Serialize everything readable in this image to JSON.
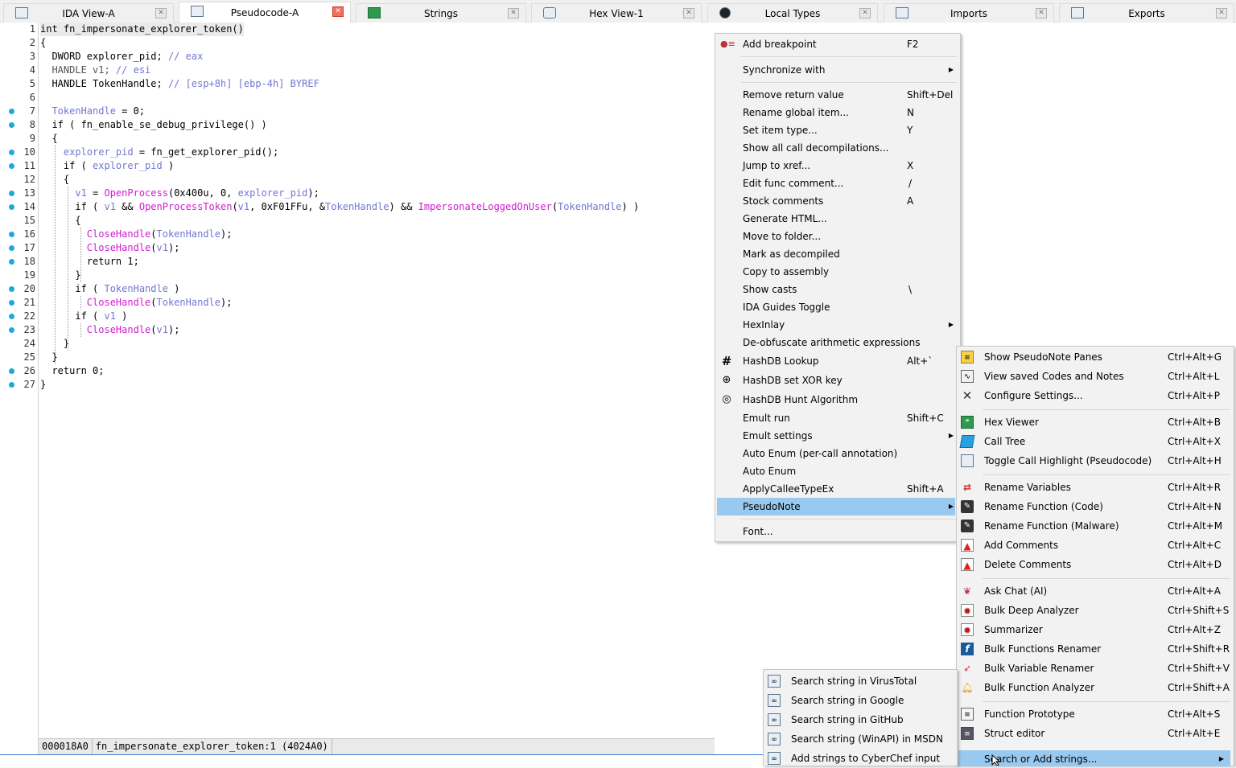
{
  "tabs": [
    {
      "label": "IDA View-A",
      "icon": "ida-view-icon"
    },
    {
      "label": "Pseudocode-A",
      "icon": "pseudocode-icon"
    },
    {
      "label": "Strings",
      "icon": "strings-icon"
    },
    {
      "label": "Hex View-1",
      "icon": "hex-view-icon"
    },
    {
      "label": "Local Types",
      "icon": "local-types-icon"
    },
    {
      "label": "Imports",
      "icon": "imports-icon"
    },
    {
      "label": "Exports",
      "icon": "exports-icon"
    }
  ],
  "line_numbers": [
    "1",
    "2",
    "3",
    "4",
    "5",
    "6",
    "7",
    "8",
    "9",
    "10",
    "11",
    "12",
    "13",
    "14",
    "15",
    "16",
    "17",
    "18",
    "19",
    "20",
    "21",
    "22",
    "23",
    "24",
    "25",
    "26",
    "27"
  ],
  "code": {
    "l1": "int fn_impersonate_explorer_token()",
    "l2": "{",
    "l3a": "  DWORD explorer_pid; ",
    "l3c": "// eax",
    "l4a": "  HANDLE v1; ",
    "l4c": "// esi",
    "l5a": "  HANDLE TokenHandle; ",
    "l5c": "// [esp+8h] [ebp-4h] BYREF",
    "l6": "",
    "l7a": "  TokenHandle",
    "l7b": " = 0;",
    "l8": "  if ( fn_enable_se_debug_privilege() )",
    "l9": "  {",
    "l10a": "    explorer_pid",
    "l10b": " = fn_get_explorer_pid();",
    "l11a": "    if ( ",
    "l11b": "explorer_pid",
    "l11c": " )",
    "l12": "    {",
    "l13a": "      v1",
    "l13b": " = ",
    "l13c": "OpenProcess",
    "l13d": "(0x400u, 0, ",
    "l13e": "explorer_pid",
    "l13f": ");",
    "l14a": "      if ( ",
    "l14b": "v1",
    "l14c": " && ",
    "l14d": "OpenProcessToken",
    "l14e": "(",
    "l14f": "v1",
    "l14g": ", 0xF01FFu, &",
    "l14h": "TokenHandle",
    "l14i": ") && ",
    "l14j": "ImpersonateLoggedOnUser",
    "l14k": "(",
    "l14l": "TokenHandle",
    "l14m": ") )",
    "l15": "      {",
    "l16a": "        ",
    "l16b": "CloseHandle",
    "l16c": "(",
    "l16d": "TokenHandle",
    "l16e": ");",
    "l17a": "        ",
    "l17b": "CloseHandle",
    "l17c": "(",
    "l17d": "v1",
    "l17e": ");",
    "l18": "        return 1;",
    "l19": "      }",
    "l20a": "      if ( ",
    "l20b": "TokenHandle",
    "l20c": " )",
    "l21a": "        ",
    "l21b": "CloseHandle",
    "l21c": "(",
    "l21d": "TokenHandle",
    "l21e": ");",
    "l22a": "      if ( ",
    "l22b": "v1",
    "l22c": " )",
    "l23a": "        ",
    "l23b": "CloseHandle",
    "l23c": "(",
    "l23d": "v1",
    "l23e": ");",
    "l24": "    }",
    "l25": "  }",
    "l26": "  return 0;",
    "l27": "}"
  },
  "status": {
    "address": "000018A0",
    "location": "fn_impersonate_explorer_token:1 (4024A0)"
  },
  "context_menu": [
    {
      "label": "Add breakpoint",
      "shortcut": "F2",
      "icon": "breakpoint-icon"
    },
    {
      "label": "Synchronize with",
      "shortcut": ""
    },
    {
      "label": "Remove return value",
      "shortcut": "Shift+Del"
    },
    {
      "label": "Rename global item...",
      "shortcut": "N"
    },
    {
      "label": "Set item type...",
      "shortcut": "Y"
    },
    {
      "label": "Show all call decompilations...",
      "shortcut": ""
    },
    {
      "label": "Jump to xref...",
      "shortcut": "X"
    },
    {
      "label": "Edit func comment...",
      "shortcut": "/"
    },
    {
      "label": "Stock comments",
      "shortcut": "A"
    },
    {
      "label": "Generate HTML...",
      "shortcut": ""
    },
    {
      "label": "Move to folder...",
      "shortcut": ""
    },
    {
      "label": "Mark as decompiled",
      "shortcut": ""
    },
    {
      "label": "Copy to assembly",
      "shortcut": ""
    },
    {
      "label": "Show casts",
      "shortcut": "\\"
    },
    {
      "label": "IDA Guides Toggle",
      "shortcut": ""
    },
    {
      "label": "HexInlay",
      "shortcut": ""
    },
    {
      "label": "De-obfuscate arithmetic expressions",
      "shortcut": ""
    },
    {
      "label": "HashDB Lookup",
      "shortcut": "Alt+`",
      "icon": "hash-icon"
    },
    {
      "label": "HashDB set XOR key",
      "shortcut": "",
      "icon": "xor-icon"
    },
    {
      "label": "HashDB Hunt Algorithm",
      "shortcut": "",
      "icon": "target-icon"
    },
    {
      "label": "Emult run",
      "shortcut": "Shift+C"
    },
    {
      "label": "Emult settings",
      "shortcut": ""
    },
    {
      "label": "Auto Enum (per-call annotation)",
      "shortcut": ""
    },
    {
      "label": "Auto Enum",
      "shortcut": ""
    },
    {
      "label": "ApplyCalleeTypeEx",
      "shortcut": "Shift+A"
    },
    {
      "label": "PseudoNote",
      "shortcut": ""
    },
    {
      "label": "Font...",
      "shortcut": ""
    }
  ],
  "pseudonote_menu": [
    {
      "label": "Show PseudoNote Panes",
      "shortcut": "Ctrl+Alt+G",
      "icon": "notes-icon"
    },
    {
      "label": "View saved Codes and Notes",
      "shortcut": "Ctrl+Alt+L",
      "icon": "chart-icon"
    },
    {
      "label": "Configure Settings...",
      "shortcut": "Ctrl+Alt+P",
      "icon": "tools-icon"
    },
    {
      "label": "Hex Viewer",
      "shortcut": "Ctrl+Alt+B",
      "icon": "hex-icon"
    },
    {
      "label": "Call Tree",
      "shortcut": "Ctrl+Alt+X",
      "icon": "tree-icon"
    },
    {
      "label": "Toggle Call Highlight (Pseudocode)",
      "shortcut": "Ctrl+Alt+H",
      "icon": "highlight-icon"
    },
    {
      "label": "Rename Variables",
      "shortcut": "Ctrl+Alt+R",
      "icon": "rename-icon"
    },
    {
      "label": "Rename Function (Code)",
      "shortcut": "Ctrl+Alt+N",
      "icon": "pen-icon"
    },
    {
      "label": "Rename Function (Malware)",
      "shortcut": "Ctrl+Alt+M",
      "icon": "pen-icon"
    },
    {
      "label": "Add Comments",
      "shortcut": "Ctrl+Alt+C",
      "icon": "comment-icon"
    },
    {
      "label": "Delete Comments",
      "shortcut": "Ctrl+Alt+D",
      "icon": "comment-icon"
    },
    {
      "label": "Ask Chat (AI)",
      "shortcut": "Ctrl+Alt+A",
      "icon": "chat-icon"
    },
    {
      "label": "Bulk Deep Analyzer",
      "shortcut": "Ctrl+Shift+S",
      "icon": "bug-icon"
    },
    {
      "label": "Summarizer",
      "shortcut": "Ctrl+Alt+Z",
      "icon": "bug-icon"
    },
    {
      "label": "Bulk Functions Renamer",
      "shortcut": "Ctrl+Shift+R",
      "icon": "function-icon"
    },
    {
      "label": "Bulk Variable Renamer",
      "shortcut": "Ctrl+Shift+V",
      "icon": "rocket-icon"
    },
    {
      "label": "Bulk Function Analyzer",
      "shortcut": "Ctrl+Shift+A",
      "icon": "bell-icon"
    },
    {
      "label": "Function Prototype",
      "shortcut": "Ctrl+Alt+S",
      "icon": "prototype-icon"
    },
    {
      "label": "Struct editor",
      "shortcut": "Ctrl+Alt+E",
      "icon": "struct-icon"
    },
    {
      "label": "Search or Add strings...",
      "shortcut": "",
      "icon": ""
    }
  ],
  "strings_menu": [
    {
      "label": "Search string in VirusTotal",
      "icon": "binoculars-icon"
    },
    {
      "label": "Search string in Google",
      "icon": "binoculars-icon"
    },
    {
      "label": "Search string in GitHub",
      "icon": "binoculars-icon"
    },
    {
      "label": "Search string (WinAPI) in MSDN",
      "icon": "binoculars-icon"
    },
    {
      "label": "Add strings to CyberChef input",
      "icon": "binoculars-icon"
    }
  ],
  "colors": {
    "selection": "#99c9ef",
    "keyword": "#000000",
    "variable": "#7276d2",
    "api_call": "#d21ad2",
    "breakpoint_dot": "#1fa9d8"
  }
}
